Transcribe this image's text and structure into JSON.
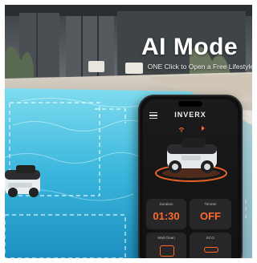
{
  "hero": {
    "title": "AI Mode",
    "subtitle": "ONE Click to Open a Free Lifestyle"
  },
  "app": {
    "brand": "INVERX",
    "status_icons": [
      "wifi-icon",
      "signal-icon"
    ],
    "menu_icon": "menu-icon",
    "tiles": [
      {
        "label": "Duration",
        "value": "01:30"
      },
      {
        "label": "Timmer",
        "value": "OFF"
      },
      {
        "label": "Wall Clean",
        "icon": "wall-clean-icon"
      },
      {
        "label": "ECO",
        "icon": "eco-icon"
      }
    ]
  },
  "colors": {
    "accent": "#ff6a2a",
    "pool_water": "#5fd0e8",
    "pool_deep": "#1c9ac4",
    "phone_bg": "#161617"
  }
}
